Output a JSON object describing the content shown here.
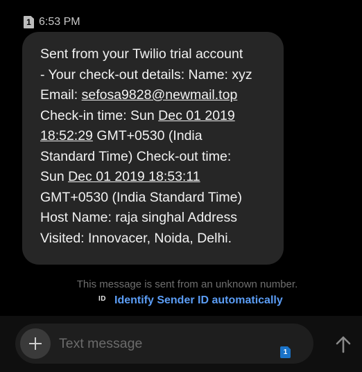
{
  "message": {
    "sim_number": "1",
    "time": "6:53 PM",
    "body_lines": [
      {
        "parts": [
          {
            "text": "Sent from your Twilio trial account"
          }
        ]
      },
      {
        "parts": [
          {
            "text": "- Your check-out details: Name: xyz"
          }
        ]
      },
      {
        "parts": [
          {
            "text": "Email: "
          },
          {
            "text": "sefosa9828@newmail.top",
            "link": true
          }
        ]
      },
      {
        "parts": [
          {
            "text": "Check-in time: Sun "
          },
          {
            "text": "Dec 01 2019",
            "link": true
          }
        ]
      },
      {
        "parts": [
          {
            "text": "18:52:29",
            "link": true
          },
          {
            "text": " GMT+0530 (India"
          }
        ]
      },
      {
        "parts": [
          {
            "text": "Standard Time) Check-out time:"
          }
        ]
      },
      {
        "parts": [
          {
            "text": "Sun "
          },
          {
            "text": "Dec 01 2019 18:53:11",
            "link": true
          }
        ]
      },
      {
        "parts": [
          {
            "text": "GMT+0530 (India Standard Time)"
          }
        ]
      },
      {
        "parts": [
          {
            "text": "Host Name: raja singhal Address"
          }
        ]
      },
      {
        "parts": [
          {
            "text": "Visited: Innovacer, Noida, Delhi."
          }
        ]
      }
    ]
  },
  "notice": {
    "unknown_number_text": "This message is sent from an unknown number.",
    "id_icon_label": "ID",
    "identify_link_text": "Identify Sender ID automatically"
  },
  "composer": {
    "placeholder": "Text message",
    "sim_select": "1",
    "add_icon": "plus-icon",
    "send_icon": "arrow-up-icon"
  },
  "colors": {
    "background": "#000000",
    "bubble": "#262626",
    "link_accent": "#5b9df5",
    "sim_badge_active": "#1a73c9"
  }
}
